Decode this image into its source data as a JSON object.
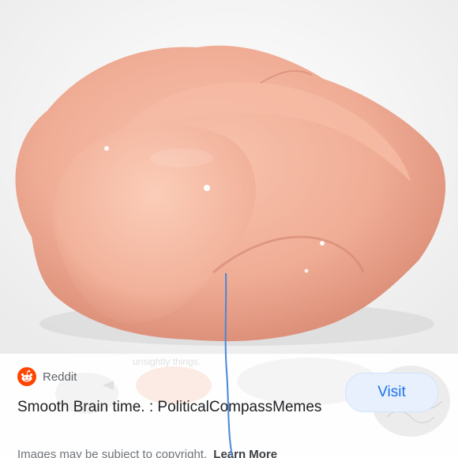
{
  "result": {
    "source_name": "Reddit",
    "source_icon": "reddit-logo-icon",
    "title": "Smooth Brain time. : PoliticalCompassMemes",
    "visit_label": "Visit",
    "copyright_text": "Images may be subject to copyright.",
    "learn_more_label": "Learn More"
  },
  "background": {
    "ghost_caption": "unsightly things."
  },
  "colors": {
    "accent": "#1a73e8",
    "reddit_orange": "#ff4500",
    "pen_blue": "#4a86d8"
  }
}
